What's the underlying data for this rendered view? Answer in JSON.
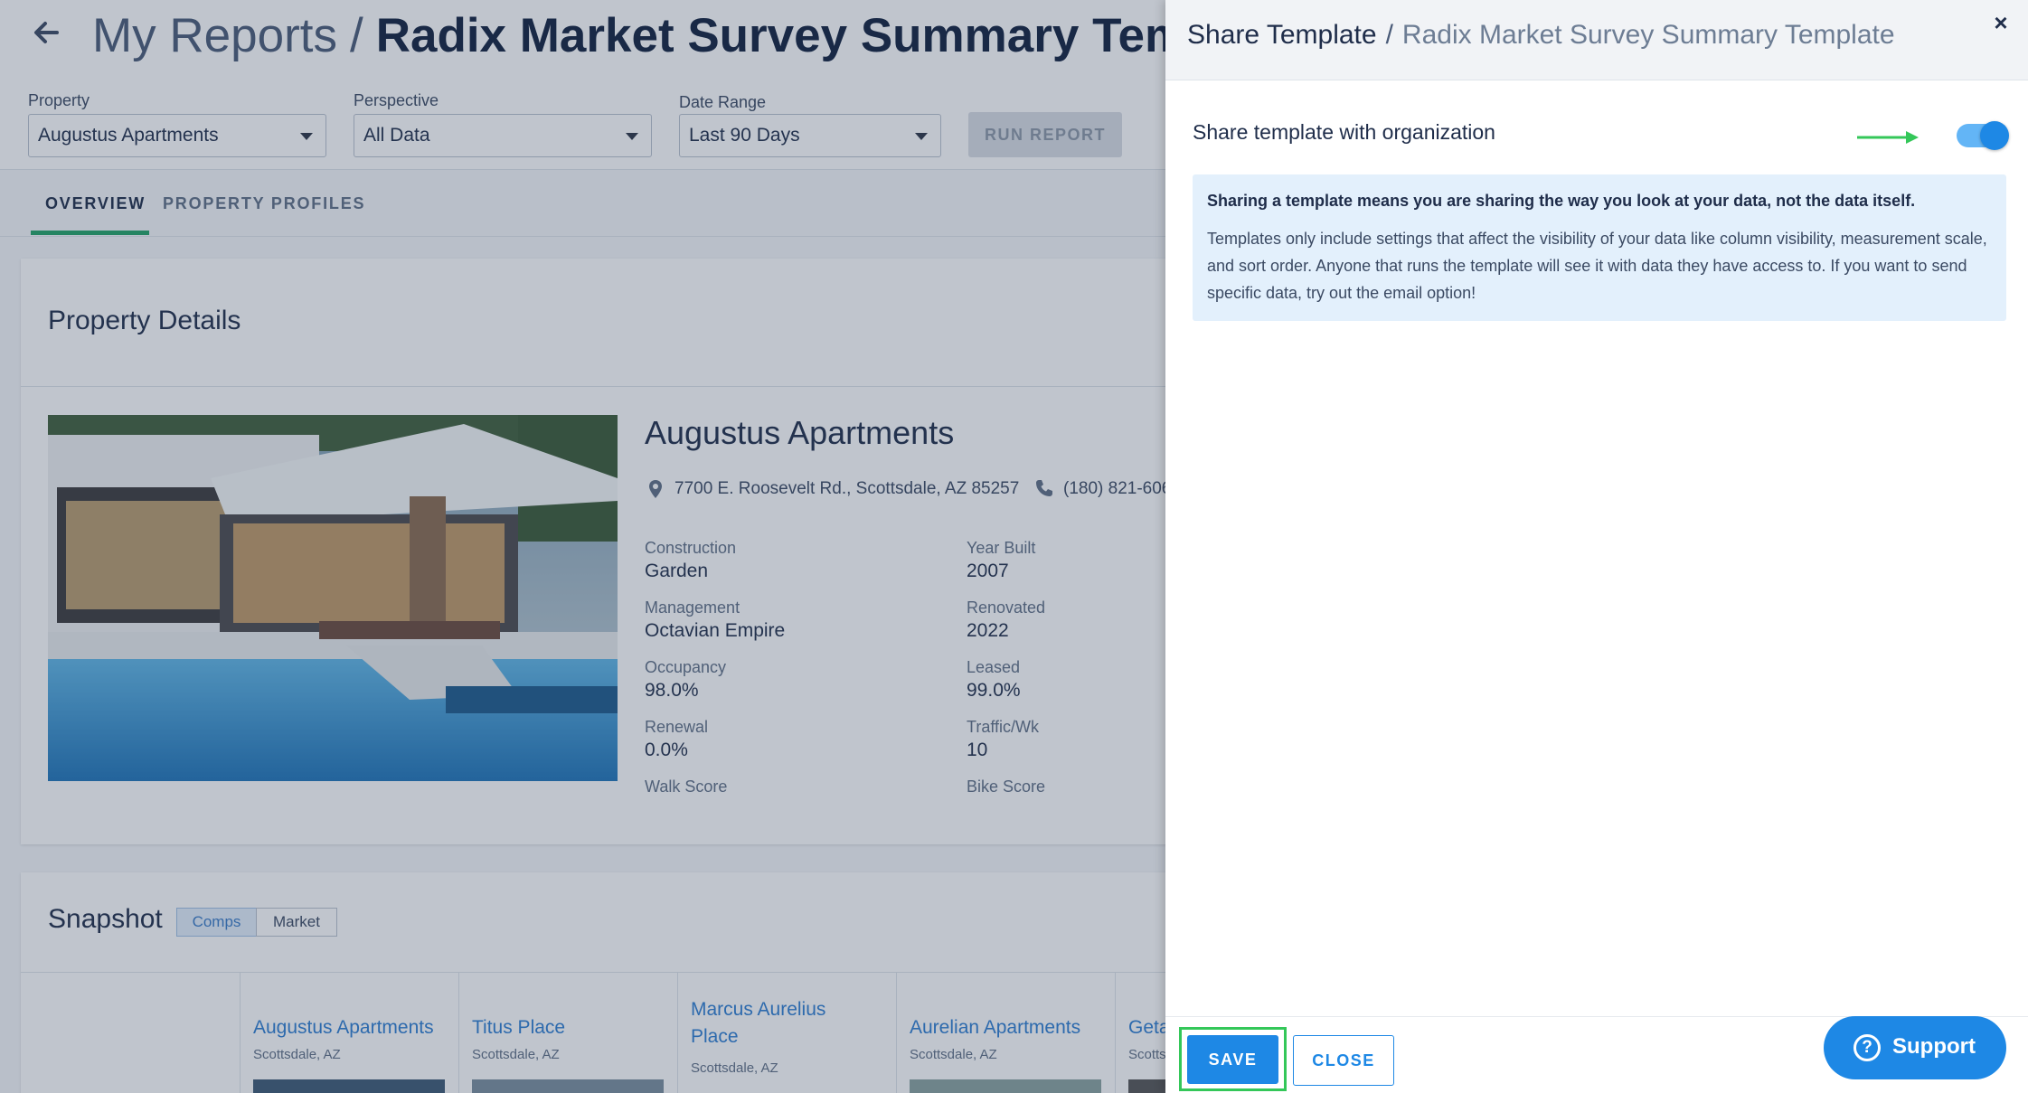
{
  "header": {
    "crumb": "My Reports",
    "separator": "/",
    "title": "Radix Market Survey Summary Template"
  },
  "filters": {
    "property": {
      "label": "Property",
      "value": "Augustus Apartments"
    },
    "perspective": {
      "label": "Perspective",
      "value": "All Data"
    },
    "date_range": {
      "label": "Date Range",
      "value": "Last 90 Days"
    },
    "run_label": "RUN REPORT"
  },
  "tabs": [
    "OVERVIEW",
    "PROPERTY PROFILES"
  ],
  "property_details": {
    "heading": "Property Details",
    "name": "Augustus Apartments",
    "address": "7700 E. Roosevelt Rd., Scottsdale, AZ 85257",
    "phone": "(180) 821-606",
    "fields": [
      {
        "label": "Construction",
        "value": "Garden"
      },
      {
        "label": "Year Built",
        "value": "2007"
      },
      {
        "label": "Management",
        "value": "Octavian Empire"
      },
      {
        "label": "Renovated",
        "value": "2022"
      },
      {
        "label": "Occupancy",
        "value": "98.0%"
      },
      {
        "label": "Leased",
        "value": "99.0%"
      },
      {
        "label": "Renewal",
        "value": "0.0%"
      },
      {
        "label": "Traffic/Wk",
        "value": "10"
      },
      {
        "label": "Walk Score",
        "value": ""
      },
      {
        "label": "Bike Score",
        "value": ""
      }
    ]
  },
  "snapshot": {
    "heading": "Snapshot",
    "toggle": [
      "Comps",
      "Market"
    ],
    "comps": [
      {
        "name": "Augustus Apartments",
        "city": "Scottsdale, AZ"
      },
      {
        "name": "Titus Place",
        "city": "Scottsdale, AZ"
      },
      {
        "name": "Marcus Aurelius Place",
        "city": "Scottsdale, AZ"
      },
      {
        "name": "Aurelian Apartments",
        "city": "Scottsdale, AZ"
      },
      {
        "name": "Geta",
        "city": "Scotts"
      }
    ]
  },
  "drawer": {
    "title": "Share Template",
    "separator": "/",
    "subtitle": "Radix Market Survey Summary Template",
    "close_symbol": "×",
    "share_label": "Share template with organization",
    "share_enabled": true,
    "info_strong": "Sharing a template means you are sharing the way you look at your data, not the data itself.",
    "info_body": "Templates only include settings that affect the visibility of your data like column visibility, measurement scale, and sort order. Anyone that runs the template will see it with data they have access to. If you want to send specific data, try out the email option!",
    "save_label": "SAVE",
    "close_label": "CLOSE"
  },
  "support": {
    "symbol": "?",
    "label": "Support"
  },
  "colors": {
    "accent": "#1e88e5",
    "tab_indicator": "#21a366",
    "highlight": "#34c759",
    "link": "#2d7dd2"
  },
  "icons": [
    "back-arrow-icon",
    "caret-down-icon",
    "map-pin-icon",
    "phone-icon",
    "close-icon",
    "help-circle-icon"
  ]
}
